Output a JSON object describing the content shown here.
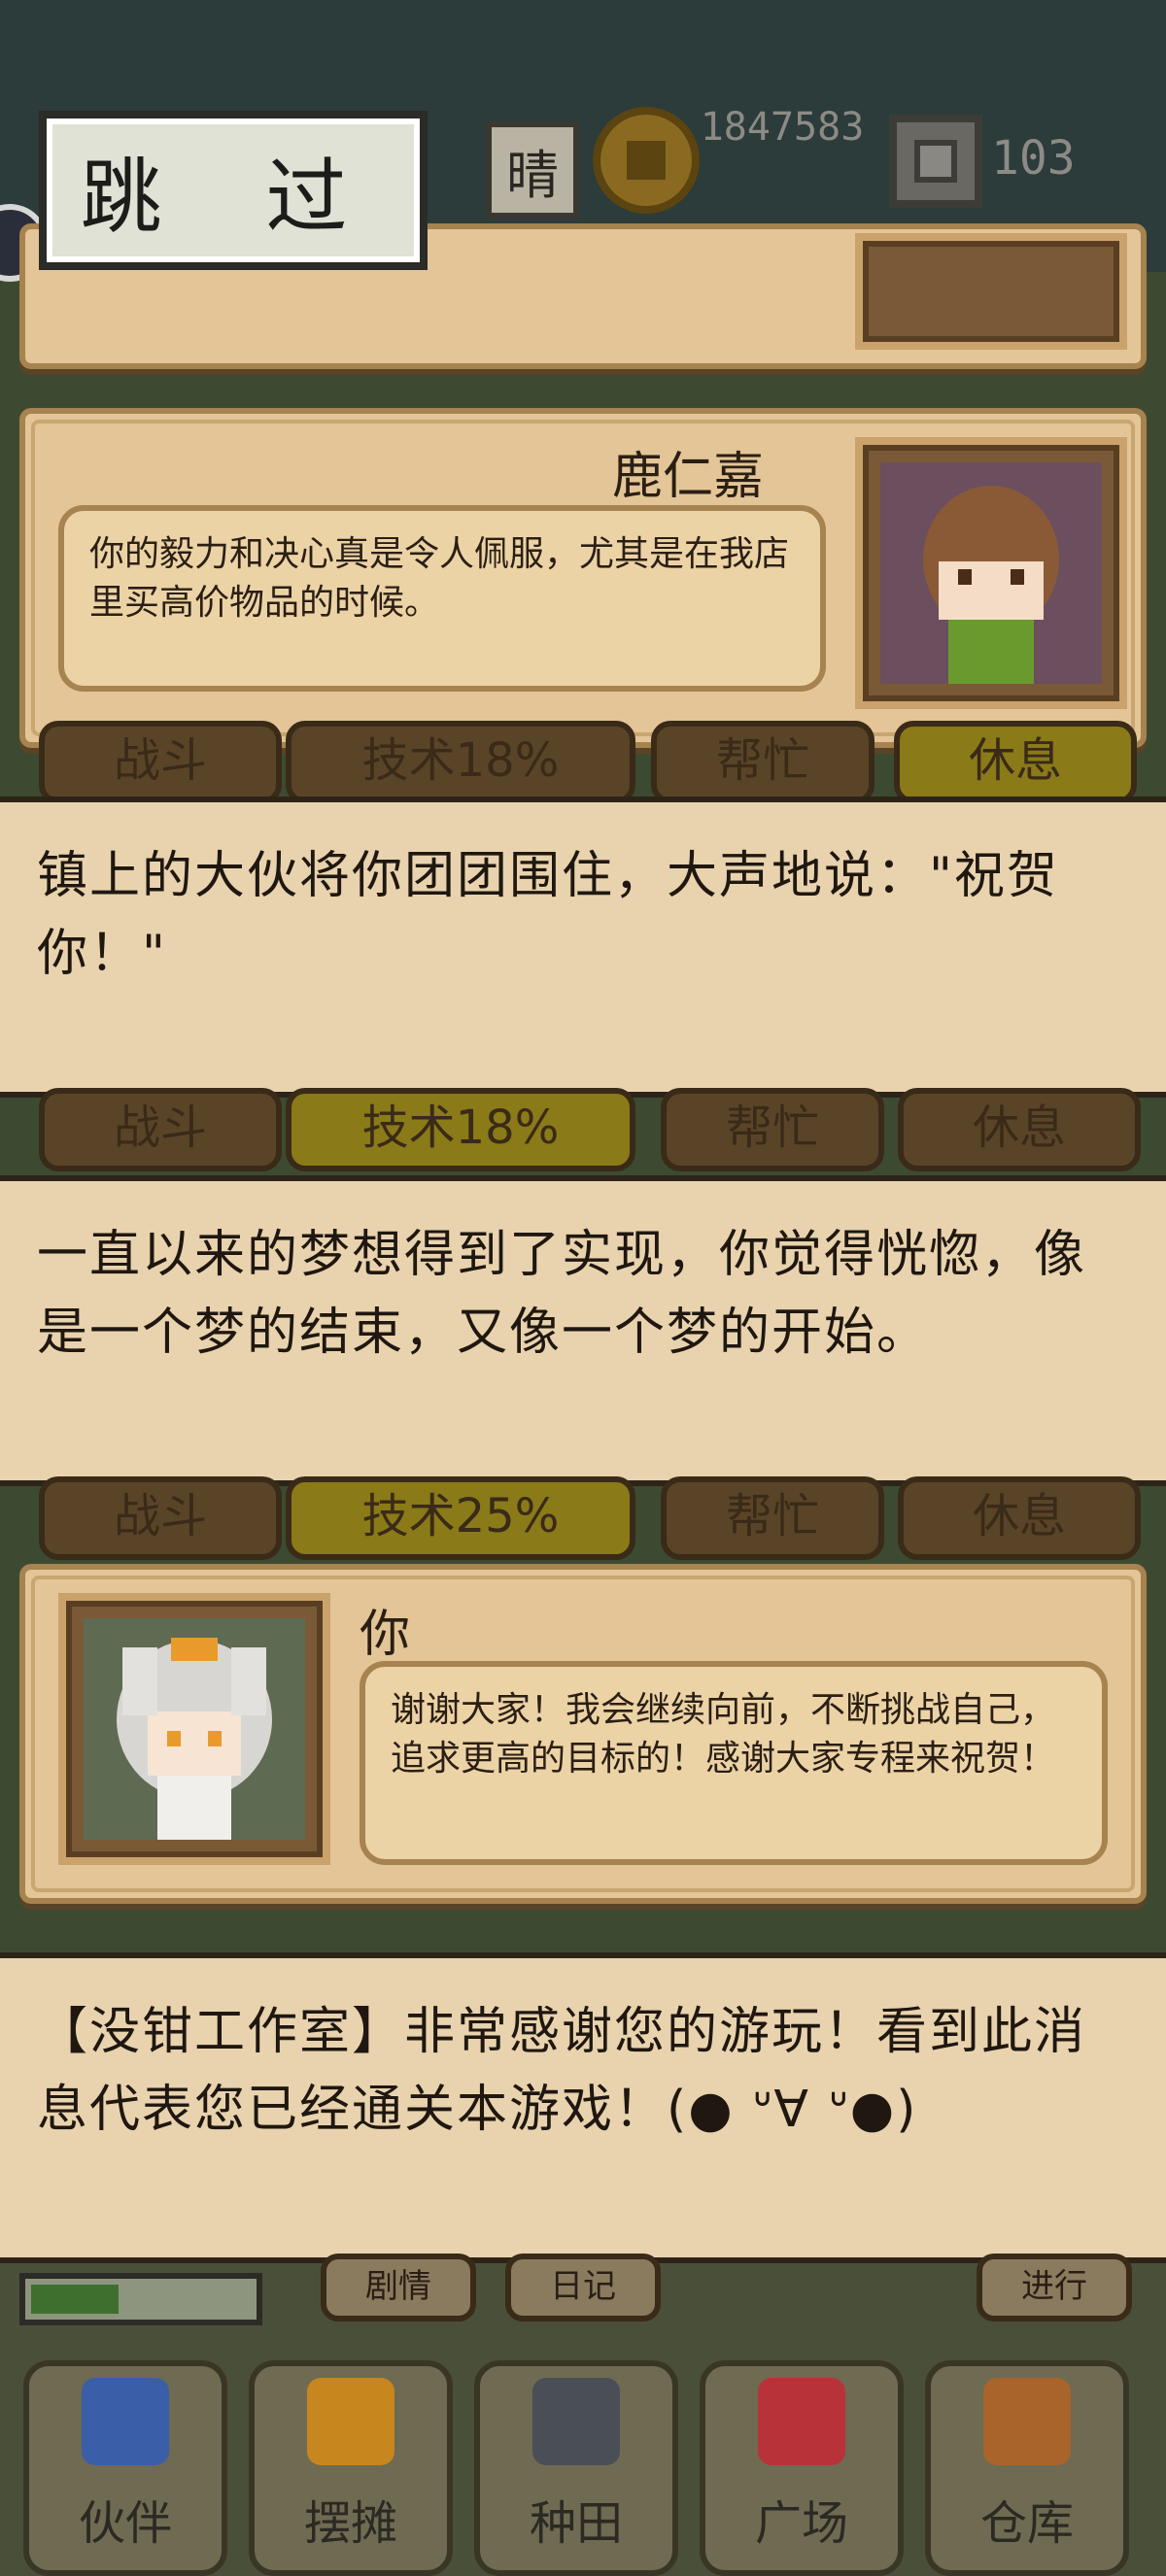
{
  "header": {
    "skip_label": "跳 过",
    "weather": "晴",
    "coins": "1847583",
    "gems": "103"
  },
  "dialogues": [
    {
      "speaker": "鹿仁嘉",
      "text": "你的毅力和决心真是令人佩服，尤其是在我店里买高价物品的时候。"
    },
    {
      "speaker": "你",
      "text": "谢谢大家！我会继续向前，不断挑战自己，追求更高的目标的！感谢大家专程来祝贺！"
    }
  ],
  "narrations": [
    "镇上的大伙将你团团围住，大声地说：\"祝贺你！\"",
    "一直以来的梦想得到了实现，你觉得恍惚，像是一个梦的结束，又像一个梦的开始。",
    "【没钳工作室】非常感谢您的游玩！看到此消息代表您已经通关本游戏！(● ᐡ∀ ᐡ●)"
  ],
  "action_row_1": [
    "战斗",
    "技术18%",
    "帮忙",
    "休息"
  ],
  "action_row_2": [
    "战斗",
    "技术25%",
    "帮忙",
    "休息"
  ],
  "bottom_buttons": {
    "story": "剧情",
    "diary": "日记",
    "proceed": "进行"
  },
  "progress": 0.4,
  "nav": [
    "伙伴",
    "摆摊",
    "种田",
    "广场",
    "仓库"
  ],
  "colors": {
    "panel": "#e3c597",
    "narration": "#e8d3ae",
    "skip_button": "#dfe2d4"
  }
}
